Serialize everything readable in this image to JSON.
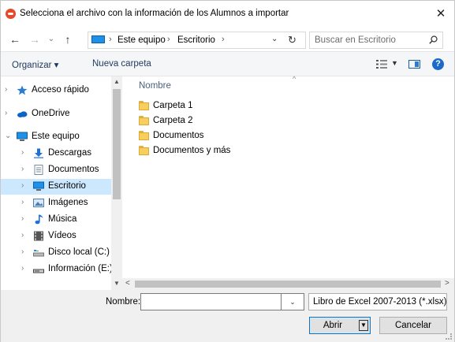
{
  "window": {
    "title": "Selecciona el archivo con la información de los Alumnos a importar",
    "close_glyph": "✕"
  },
  "nav": {
    "back_glyph": "←",
    "forward_glyph": "→",
    "recent_glyph": "⌄",
    "up_glyph": "↑"
  },
  "address": {
    "crumbs": [
      "Este equipo",
      "Escritorio"
    ],
    "separator": "›",
    "refresh_glyph": "↻",
    "dropdown_glyph": "⌄"
  },
  "search": {
    "placeholder": "Buscar en Escritorio"
  },
  "toolbar": {
    "organize_label": "Organizar ▾",
    "new_folder_label": "Nueva carpeta",
    "help_label": "?"
  },
  "sidebar": {
    "items": [
      {
        "label": "Acceso rápido",
        "icon": "star-icon",
        "color": "#2b7cd3"
      },
      {
        "label": "OneDrive",
        "icon": "cloud-icon",
        "color": "#0a64c8"
      },
      {
        "label": "Este equipo",
        "icon": "computer-icon",
        "color": "#1e90e8"
      },
      {
        "label": "Descargas",
        "icon": "download-icon",
        "color": "#1e6fd9"
      },
      {
        "label": "Documentos",
        "icon": "document-icon",
        "color": "#7a8ca0"
      },
      {
        "label": "Escritorio",
        "icon": "desktop-icon",
        "color": "#1e90e8",
        "selected": true
      },
      {
        "label": "Imágenes",
        "icon": "pictures-icon",
        "color": "#4a7fb5"
      },
      {
        "label": "Música",
        "icon": "music-icon",
        "color": "#1e6fd9"
      },
      {
        "label": "Vídeos",
        "icon": "video-icon",
        "color": "#555555"
      },
      {
        "label": "Disco local (C:)",
        "icon": "drive-icon",
        "color": "#1e90e8"
      },
      {
        "label": "Información (E:)",
        "icon": "drive-icon",
        "color": "#444444"
      }
    ]
  },
  "files": {
    "column_header": "Nombre",
    "items": [
      {
        "name": "Carpeta 1",
        "icon": "folder-icon"
      },
      {
        "name": "Carpeta 2",
        "icon": "folder-icon"
      },
      {
        "name": "Documentos",
        "icon": "folder-icon"
      },
      {
        "name": "Documentos y más",
        "icon": "folder-icon"
      }
    ]
  },
  "footer": {
    "name_label": "Nombre:",
    "name_value": "",
    "filetype": "Libro de Excel 2007-2013 (*.xlsx)",
    "open_label": "Abrir",
    "cancel_label": "Cancelar"
  }
}
